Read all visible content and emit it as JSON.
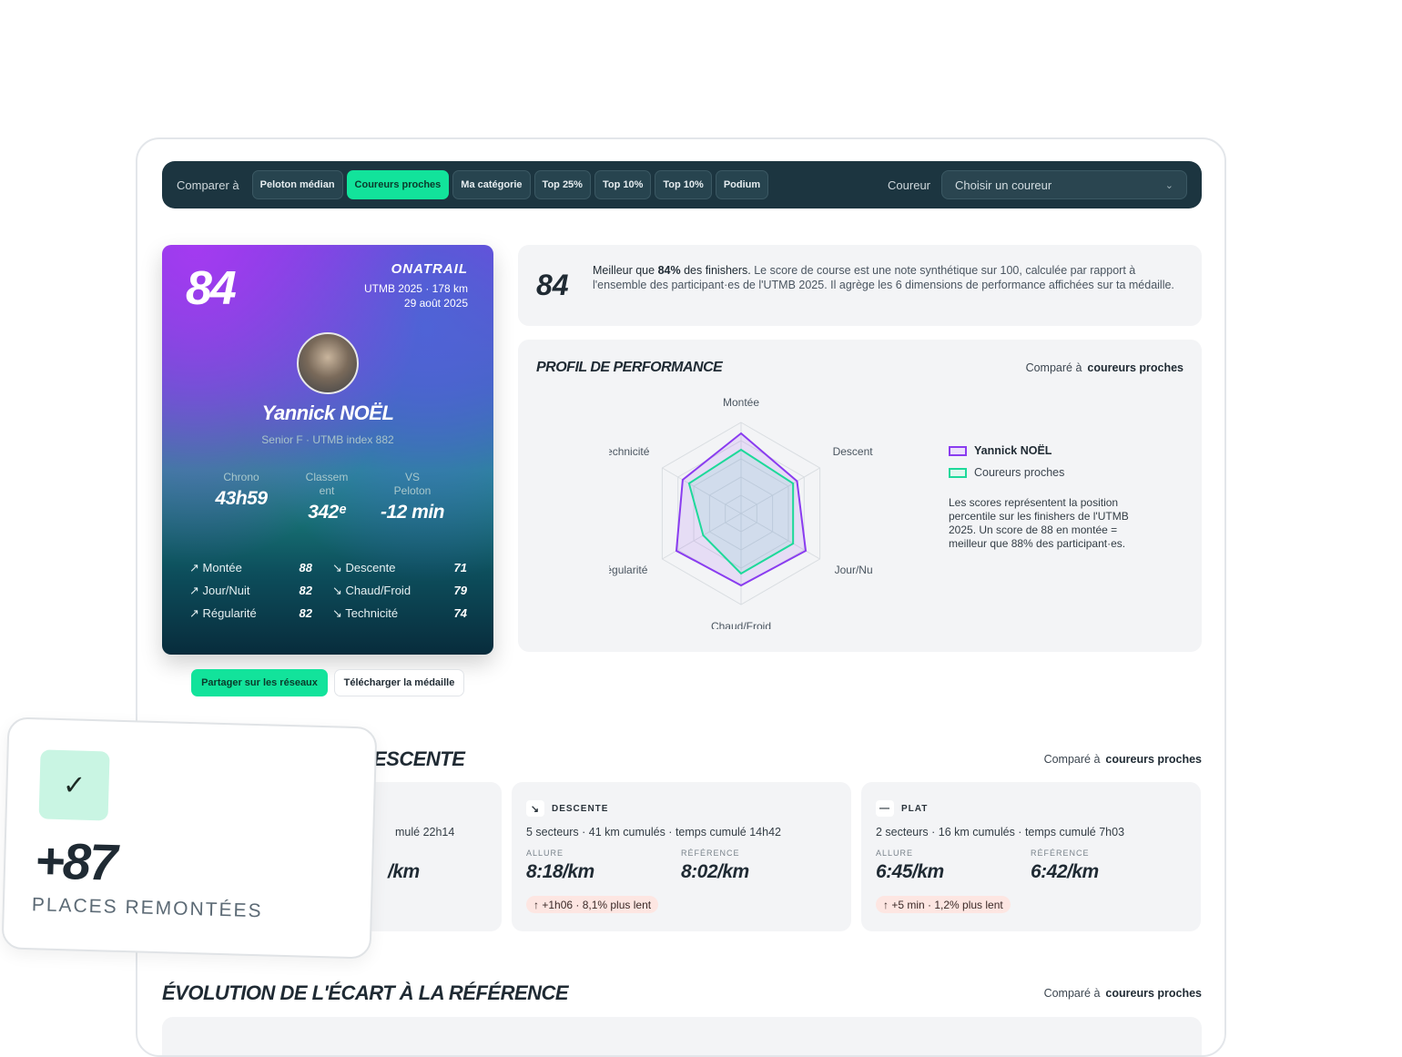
{
  "toolbar": {
    "compare_label": "Comparer à",
    "chips": [
      "Peloton médian",
      "Coureurs proches",
      "Ma catégorie",
      "Top 25%",
      "Top 10%",
      "Top 10%",
      "Podium"
    ],
    "active_chip": "Coureurs proches",
    "runner_label": "Coureur",
    "runner_select": "Choisir un coureur"
  },
  "medal": {
    "score": "84",
    "brand": "ONATRAIL",
    "race": "UTMB 2025 · 178 km",
    "date": "29 août 2025",
    "name": "Yannick NOËL",
    "subtitle": "Senior F · UTMB index 882",
    "stats": [
      {
        "label": "Chrono",
        "value": "43h59"
      },
      {
        "label": "Classem ent",
        "value": "342ᵉ"
      },
      {
        "label": "VS Peloton",
        "value": "-12 min"
      }
    ],
    "dims_left": [
      {
        "name": "Montée",
        "value": "88",
        "icon": "trend-up-icon"
      },
      {
        "name": "Jour/Nuit",
        "value": "82",
        "icon": "trend-up-icon"
      },
      {
        "name": "Régularité",
        "value": "82",
        "icon": "trend-up-icon"
      }
    ],
    "dims_right": [
      {
        "name": "Descente",
        "value": "71",
        "icon": "trend-down-icon"
      },
      {
        "name": "Chaud/Froid",
        "value": "79",
        "icon": "trend-down-icon"
      },
      {
        "name": "Technicité",
        "value": "74",
        "icon": "trend-down-icon"
      }
    ]
  },
  "actions": {
    "share": "Partager sur les réseaux",
    "download": "Télécharger la médaille"
  },
  "summary": {
    "score": "84",
    "lead": "Meilleur que ",
    "pct": "84%",
    "lead_end": " des finishers.",
    "text": " Le score de course est une note synthétique sur 100, calculée par rapport à l'ensemble des participant·es de l'UTMB 2025. Il agrège les 6 dimensions de performance affichées sur ta médaille."
  },
  "profile": {
    "title": "PROFIL DE PERFORMANCE",
    "compare_prefix": "Comparé à",
    "compare_target": "coureurs proches",
    "legend": [
      "Yannick NOËL",
      "Coureurs proches"
    ],
    "note": "Les scores représentent la position percentile sur les finishers de l'UTMB 2025. Un score de 88 en montée = meilleur que 88% des participant·es."
  },
  "chart_data": {
    "type": "radar",
    "axes": [
      "Montée",
      "Descente",
      "Jour/Nuit",
      "Chaud/Froid",
      "Régularité",
      "Technicité"
    ],
    "axis_labels_shown": [
      "Montée",
      "Descente",
      "Jour/Nui",
      "Chaud/Froid",
      "Régularité",
      "echnicité"
    ],
    "range": [
      0,
      100
    ],
    "series": [
      {
        "name": "Yannick NOËL",
        "values": [
          88,
          71,
          82,
          79,
          82,
          74
        ],
        "color": "#8a3cf0"
      },
      {
        "name": "Coureurs proches",
        "values": [
          70,
          66,
          66,
          66,
          48,
          66
        ],
        "color": "#1ed99a"
      }
    ]
  },
  "descente_section": {
    "title_visible": "ESCENTE",
    "compare_prefix": "Comparé à",
    "compare_target": "coureurs proches"
  },
  "cards": [
    {
      "kind": "",
      "icon": "",
      "desc": "mulé 22h14",
      "allure_label": "",
      "allure": "/km",
      "ref_label": "",
      "ref": "",
      "delta": ""
    },
    {
      "kind": "DESCENTE",
      "icon": "arrow-down-right-icon",
      "desc": "5 secteurs · 41 km cumulés · temps cumulé 14h42",
      "allure_label": "ALLURE",
      "allure": "8:18/km",
      "ref_label": "RÉFÉRENCE",
      "ref": "8:02/km",
      "delta": "↑ +1h06 · 8,1% plus lent"
    },
    {
      "kind": "PLAT",
      "icon": "minus-icon",
      "desc": "2 secteurs · 16 km cumulés · temps cumulé 7h03",
      "allure_label": "ALLURE",
      "allure": "6:45/km",
      "ref_label": "RÉFÉRENCE",
      "ref": "6:42/km",
      "delta": "↑ +5 min · 1,2% plus lent"
    }
  ],
  "evolution": {
    "title": "ÉVOLUTION DE L'ÉCART À LA RÉFÉRENCE",
    "compare_prefix": "Comparé à",
    "compare_target": "coureurs proches"
  },
  "toast": {
    "value": "+87",
    "label": "PLACES REMONTÉES"
  }
}
